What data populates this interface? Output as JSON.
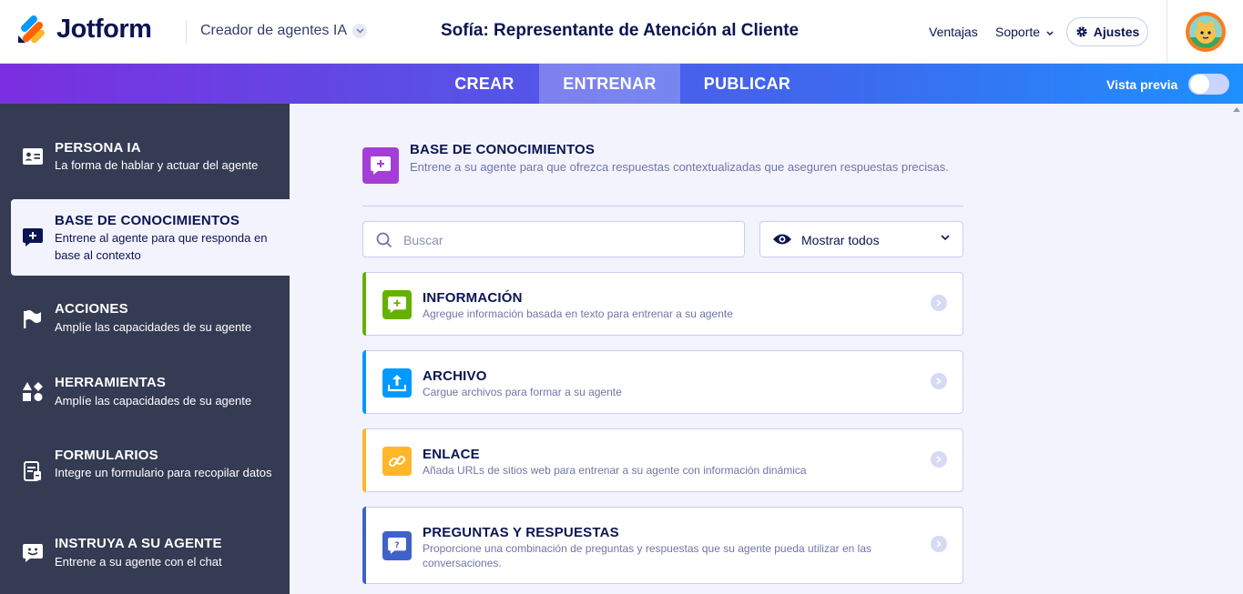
{
  "header": {
    "brand": "Jotform",
    "product": "Creador de agentes IA",
    "agent_title": "Sofía: Representante de Atención al Cliente",
    "nav": {
      "sales": "Ventajas",
      "support": "Soporte",
      "settings": "Ajustes"
    }
  },
  "tabs": [
    {
      "label": "CREAR",
      "active": false
    },
    {
      "label": "ENTRENAR",
      "active": true
    },
    {
      "label": "PUBLICAR",
      "active": false
    }
  ],
  "preview": {
    "label": "Vista previa",
    "enabled": false
  },
  "sidebar": {
    "items": [
      {
        "title": "PERSONA IA",
        "desc": "La forma de hablar y actuar del agente",
        "icon": "id-card-icon",
        "active": false
      },
      {
        "title": "BASE DE CONOCIMIENTOS",
        "desc": "Entrene al agente para que responda en base al contexto",
        "icon": "knowledge-icon",
        "active": true
      },
      {
        "title": "ACCIONES",
        "desc": "Amplíe las capacidades de su agente",
        "icon": "flag-icon",
        "active": false
      },
      {
        "title": "HERRAMIENTAS",
        "desc": "Amplíe las capacidades de su agente",
        "icon": "shapes-icon",
        "active": false
      },
      {
        "title": "FORMULARIOS",
        "desc": "Integre un formulario para recopilar datos",
        "icon": "form-icon",
        "active": false
      },
      {
        "title": "INSTRUYA A SU AGENTE",
        "desc": "Entrene a su agente con el chat",
        "icon": "chat-smile-icon",
        "active": false
      }
    ]
  },
  "main": {
    "title": "BASE DE CONOCIMIENTOS",
    "desc": "Entrene a su agente para que ofrezca respuestas contextualizadas que aseguren respuestas precisas.",
    "search_placeholder": "Buscar",
    "filter_label": "Mostrar todos",
    "cards": [
      {
        "title": "INFORMACIÓN",
        "desc": "Agregue información basada en texto para entrenar a su agente",
        "color": "#64b200",
        "icon": "text-info-icon"
      },
      {
        "title": "ARCHIVO",
        "desc": "Cargue archivos para formar a su agente",
        "color": "#0099ff",
        "icon": "upload-icon"
      },
      {
        "title": "ENLACE",
        "desc": "Añada URLs de sitios web para entrenar a su agente con información dinámica",
        "color": "#ffb629",
        "icon": "link-icon"
      },
      {
        "title": "PREGUNTAS Y RESPUESTAS",
        "desc": "Proporcione una combinación de preguntas y respuestas que su agente pueda utilizar en las conversaciones.",
        "color": "#3e62c8",
        "icon": "qa-icon"
      }
    ]
  },
  "colors": {
    "accent_purple": "#a53ed6",
    "sidebar_bg": "#343b53",
    "text_dark": "#0a1551"
  }
}
